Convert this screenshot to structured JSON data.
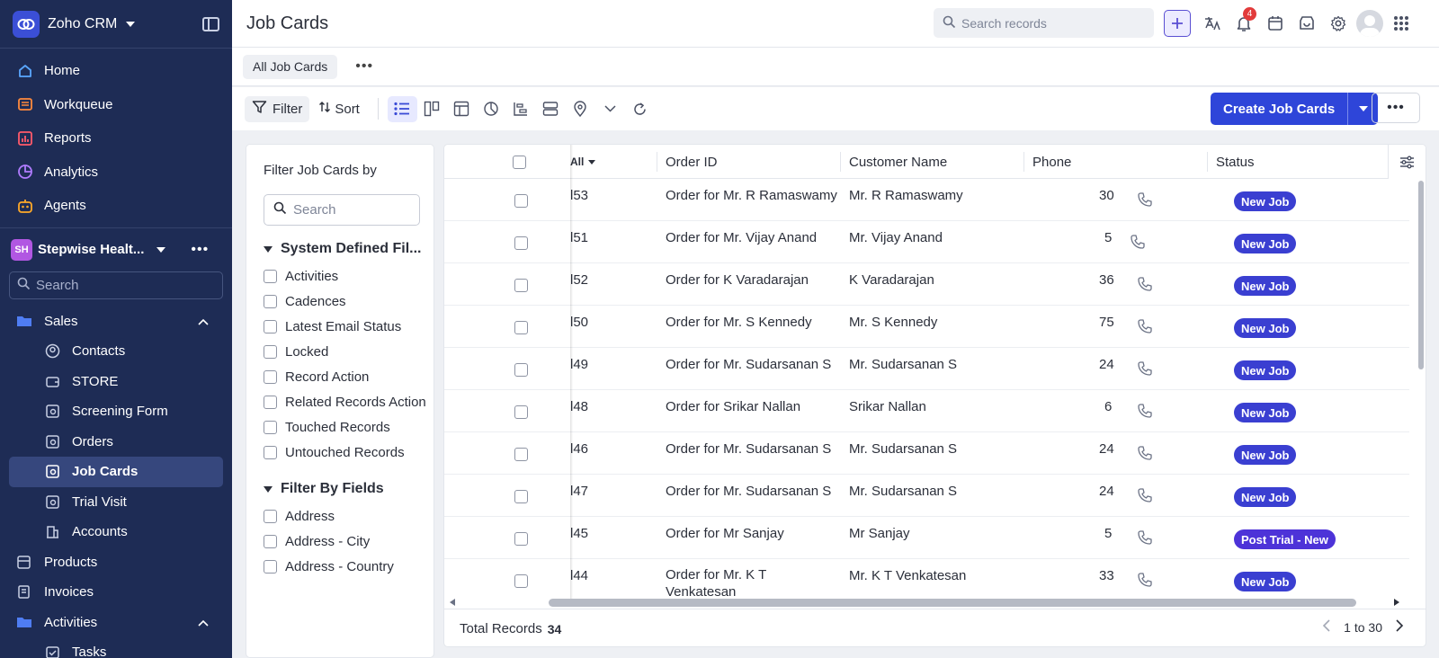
{
  "app": {
    "name": "Zoho CRM"
  },
  "sidebar": {
    "nav": [
      {
        "label": "Home",
        "icon": "home-icon"
      },
      {
        "label": "Workqueue",
        "icon": "workqueue-icon"
      },
      {
        "label": "Reports",
        "icon": "reports-icon"
      },
      {
        "label": "Analytics",
        "icon": "analytics-icon"
      },
      {
        "label": "Agents",
        "icon": "agents-icon"
      }
    ],
    "org": {
      "initials": "SH",
      "name": "Stepwise Healt..."
    },
    "search_placeholder": "Search",
    "sales_group": "Sales",
    "sales_items": [
      {
        "label": "Contacts",
        "icon": "contacts-icon"
      },
      {
        "label": "STORE",
        "icon": "store-icon"
      },
      {
        "label": "Screening Form",
        "icon": "form-icon"
      },
      {
        "label": "Orders",
        "icon": "orders-icon"
      },
      {
        "label": "Job Cards",
        "icon": "jobcards-icon",
        "active": true
      },
      {
        "label": "Trial Visit",
        "icon": "trialvisit-icon"
      },
      {
        "label": "Accounts",
        "icon": "accounts-icon"
      }
    ],
    "products": "Products",
    "invoices": "Invoices",
    "activities_group": "Activities",
    "tasks": "Tasks"
  },
  "header": {
    "title": "Job Cards",
    "search_placeholder": "Search records",
    "notifications_count": "4"
  },
  "views": {
    "current": "All Job Cards"
  },
  "toolbar": {
    "filter": "Filter",
    "sort": "Sort",
    "create": "Create Job Cards"
  },
  "filter_panel": {
    "title": "Filter Job Cards by",
    "search_placeholder": "Search",
    "system_section": "System Defined Fil...",
    "system_filters": [
      "Activities",
      "Cadences",
      "Latest Email Status",
      "Locked",
      "Record Action",
      "Related Records Action",
      "Touched Records",
      "Untouched Records"
    ],
    "fields_section": "Filter By Fields",
    "field_filters": [
      "Address",
      "Address - City",
      "Address - Country"
    ]
  },
  "grid": {
    "columns": {
      "first": "All",
      "order_id": "Order ID",
      "customer": "Customer Name",
      "phone": "Phone",
      "status": "Status"
    },
    "rows": [
      {
        "id": "l53",
        "order": "Order for Mr. R Ramaswamy",
        "customer": "Mr. R Ramaswamy",
        "phone": "30",
        "status": "New Job"
      },
      {
        "id": "l51",
        "order": "Order for Mr. Vijay Anand",
        "customer": "Mr. Vijay Anand",
        "phone": "5",
        "status": "New Job"
      },
      {
        "id": "l52",
        "order": "Order for K Varadarajan",
        "customer": "K Varadarajan",
        "phone": "36",
        "status": "New Job"
      },
      {
        "id": "l50",
        "order": "Order for Mr. S Kennedy",
        "customer": "Mr. S Kennedy",
        "phone": "75",
        "status": "New Job"
      },
      {
        "id": "l49",
        "order": "Order for Mr. Sudarsanan S",
        "customer": "Mr. Sudarsanan S",
        "phone": "24",
        "status": "New Job"
      },
      {
        "id": "l48",
        "order": "Order for Srikar Nallan",
        "customer": "Srikar Nallan",
        "phone": "6",
        "status": "New Job"
      },
      {
        "id": "l46",
        "order": "Order for Mr. Sudarsanan S",
        "customer": "Mr. Sudarsanan S",
        "phone": "24",
        "status": "New Job"
      },
      {
        "id": "l47",
        "order": "Order for Mr. Sudarsanan S",
        "customer": "Mr. Sudarsanan S",
        "phone": "24",
        "status": "New Job"
      },
      {
        "id": "l45",
        "order": "Order for Mr Sanjay",
        "customer": "Mr Sanjay",
        "phone": "5",
        "status": "Post Trial - New"
      },
      {
        "id": "l44",
        "order": "Order for Mr. K T Venkatesan",
        "customer": "Mr. K T Venkatesan",
        "phone": "33",
        "status": "New Job"
      }
    ],
    "total_label": "Total Records",
    "total_count": "34",
    "page_range": "1 to 30"
  },
  "colors": {
    "sidebar": "#1e2c55",
    "accent": "#2e45d9",
    "status_new": "#3a3fd1",
    "status_post": "#4d33d8"
  }
}
